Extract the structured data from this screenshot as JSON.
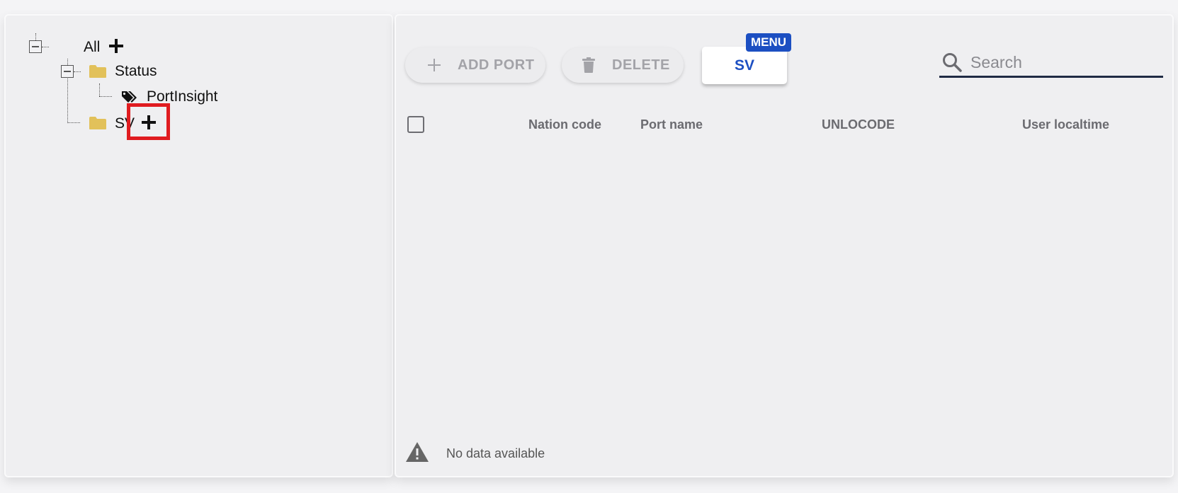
{
  "tree": {
    "root": {
      "label": "All"
    },
    "children": [
      {
        "label": "Status",
        "icon": "folder-icon",
        "children": [
          {
            "label": "PortInsight",
            "icon": "tags-icon"
          }
        ]
      },
      {
        "label": "SV",
        "icon": "folder-icon"
      }
    ]
  },
  "toolbar": {
    "add_port_label": "ADD PORT",
    "delete_label": "DELETE",
    "sv_label": "SV",
    "menu_badge": "MENU"
  },
  "search": {
    "placeholder": "Search",
    "value": ""
  },
  "table": {
    "columns": [
      "Nation code",
      "Port name",
      "UNLOCODE",
      "User localtime"
    ],
    "rows": [],
    "empty_text": "No data available"
  },
  "colors": {
    "accent": "#1c4fc2",
    "folder": "#e2c15a",
    "highlight": "#e01c20",
    "search_underline": "#1f2a44"
  }
}
